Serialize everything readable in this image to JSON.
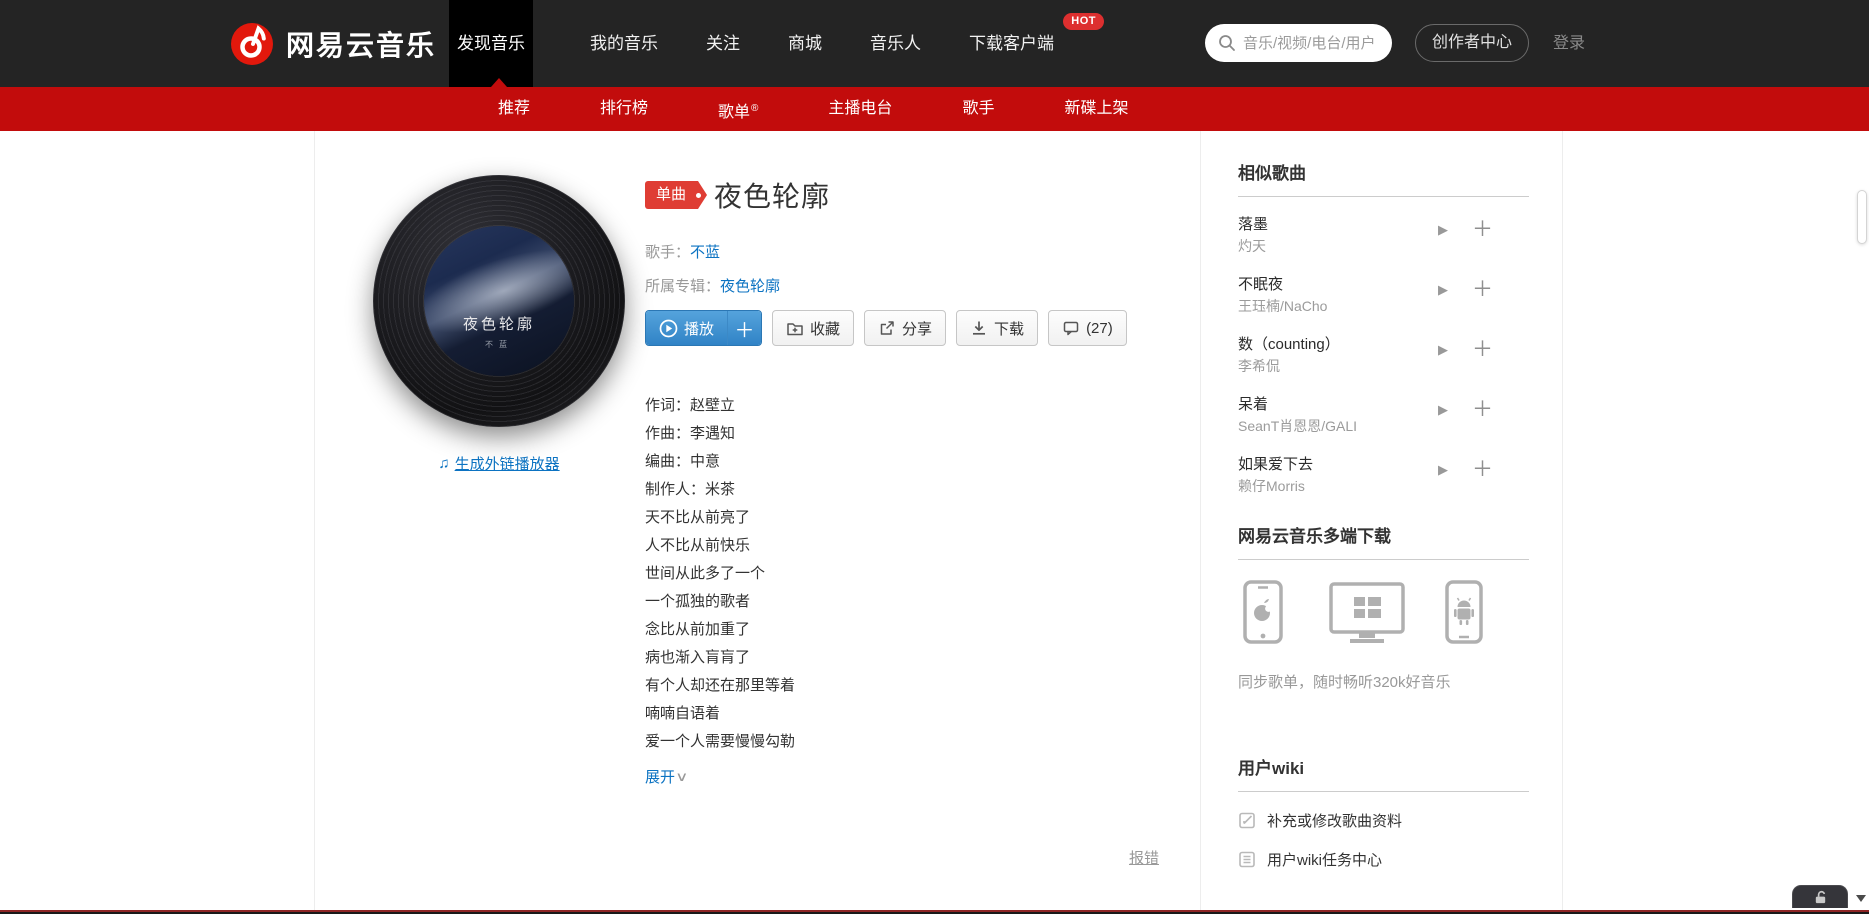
{
  "topnav": {
    "logo": "网易云音乐",
    "items": [
      {
        "label": "发现音乐",
        "active": true
      },
      {
        "label": "我的音乐"
      },
      {
        "label": "关注"
      },
      {
        "label": "商城"
      },
      {
        "label": "音乐人"
      },
      {
        "label": "下载客户端",
        "badge": "HOT"
      }
    ],
    "search_placeholder": "音乐/视频/电台/用户",
    "creator_center_label": "创作者中心",
    "login_label": "登录"
  },
  "subnav": {
    "items": [
      {
        "label": "推荐"
      },
      {
        "label": "排行榜"
      },
      {
        "label": "歌单",
        "sup": "®"
      },
      {
        "label": "主播电台"
      },
      {
        "label": "歌手"
      },
      {
        "label": "新碟上架"
      }
    ]
  },
  "song": {
    "type_badge": "单曲",
    "title": "夜色轮廓",
    "artist_label": "歌手：",
    "artist": "不蓝",
    "album_label": "所属专辑：",
    "album": "夜色轮廓",
    "cover_title": "夜色轮廓",
    "cover_artist": "不蓝",
    "external_player_label": "生成外链播放器",
    "external_player_icon": "♫",
    "buttons": {
      "play": "播放",
      "plus": "＋",
      "collect": "收藏",
      "share": "分享",
      "download": "下载",
      "comments": "(27)"
    },
    "lyrics": [
      "作词：赵壁立",
      "作曲：李遇知",
      "编曲：中意",
      "制作人：米茶",
      "天不比从前亮了",
      "人不比从前快乐",
      "世间从此多了一个",
      "一个孤独的歌者",
      "念比从前加重了",
      "病也渐入肓肓了",
      "有个人却还在那里等着",
      "喃喃自语着",
      "爱一个人需要慢慢勾勒"
    ],
    "expand_label": "展开",
    "expand_chevron": "∨",
    "report_label": "报错"
  },
  "sidebar": {
    "similar_title": "相似歌曲",
    "similar_songs": [
      {
        "title": "落墨",
        "artist": "灼天"
      },
      {
        "title": "不眠夜",
        "artist": "王珏楠/NaCho"
      },
      {
        "title": "数（counting）",
        "artist": "李希侃"
      },
      {
        "title": "呆着",
        "artist": "SeanT肖恩恩/GALI"
      },
      {
        "title": "如果爱下去",
        "artist": "赖仔Morris"
      }
    ],
    "play_glyph": "▶",
    "plus_glyph": "＋",
    "download_title": "网易云音乐多端下载",
    "download_tip": "同步歌单，随时畅听320k好音乐",
    "wiki_title": "用户wiki",
    "wiki_items": [
      "补充或修改歌曲资料",
      "用户wiki任务中心"
    ]
  },
  "colors": {
    "nav_bg": "#242424",
    "bar_red": "#c20c0c",
    "link_blue": "#0c73c2",
    "badge_red": "#df3d34",
    "play_blue": "#3083c6"
  }
}
